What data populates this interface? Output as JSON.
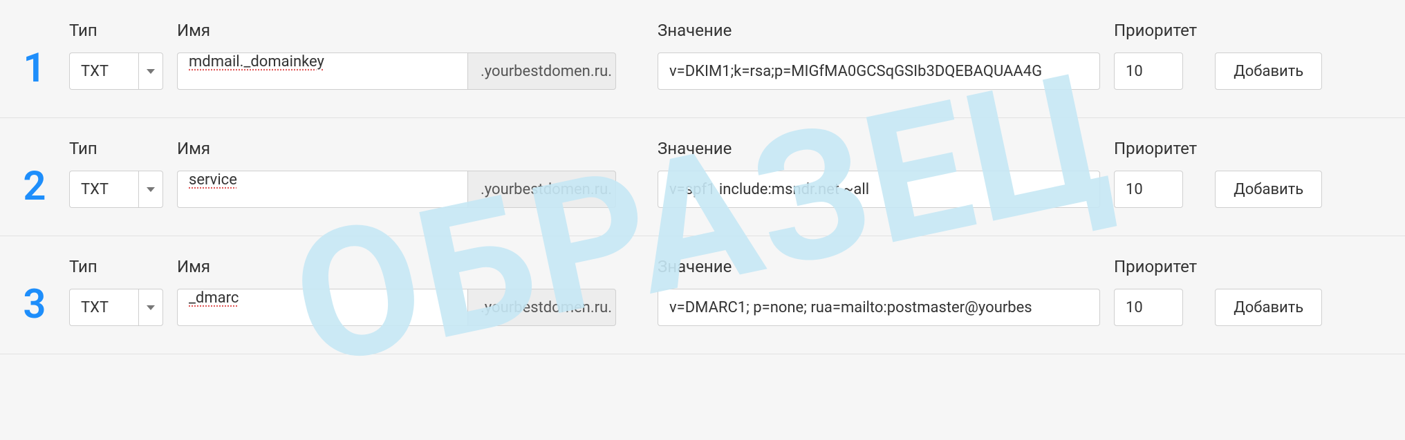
{
  "watermark": "ОБРАЗЕЦ",
  "headers": {
    "type": "Тип",
    "name": "Имя",
    "value": "Значение",
    "priority": "Приоритет"
  },
  "domain_suffix": ".yourbestdomen.ru.",
  "add_button": "Добавить",
  "rows": [
    {
      "num": "1",
      "type": "TXT",
      "name": "mdmail._domainkey",
      "value": "v=DKIM1;k=rsa;p=MIGfMA0GCSqGSIb3DQEBAQUAA4G",
      "priority": "10"
    },
    {
      "num": "2",
      "type": "TXT",
      "name": "service",
      "value": "v=spf1 include:msndr.net ~all",
      "priority": "10"
    },
    {
      "num": "3",
      "type": "TXT",
      "name": "_dmarc",
      "value": "v=DMARC1; p=none; rua=mailto:postmaster@yourbes",
      "priority": "10"
    }
  ]
}
